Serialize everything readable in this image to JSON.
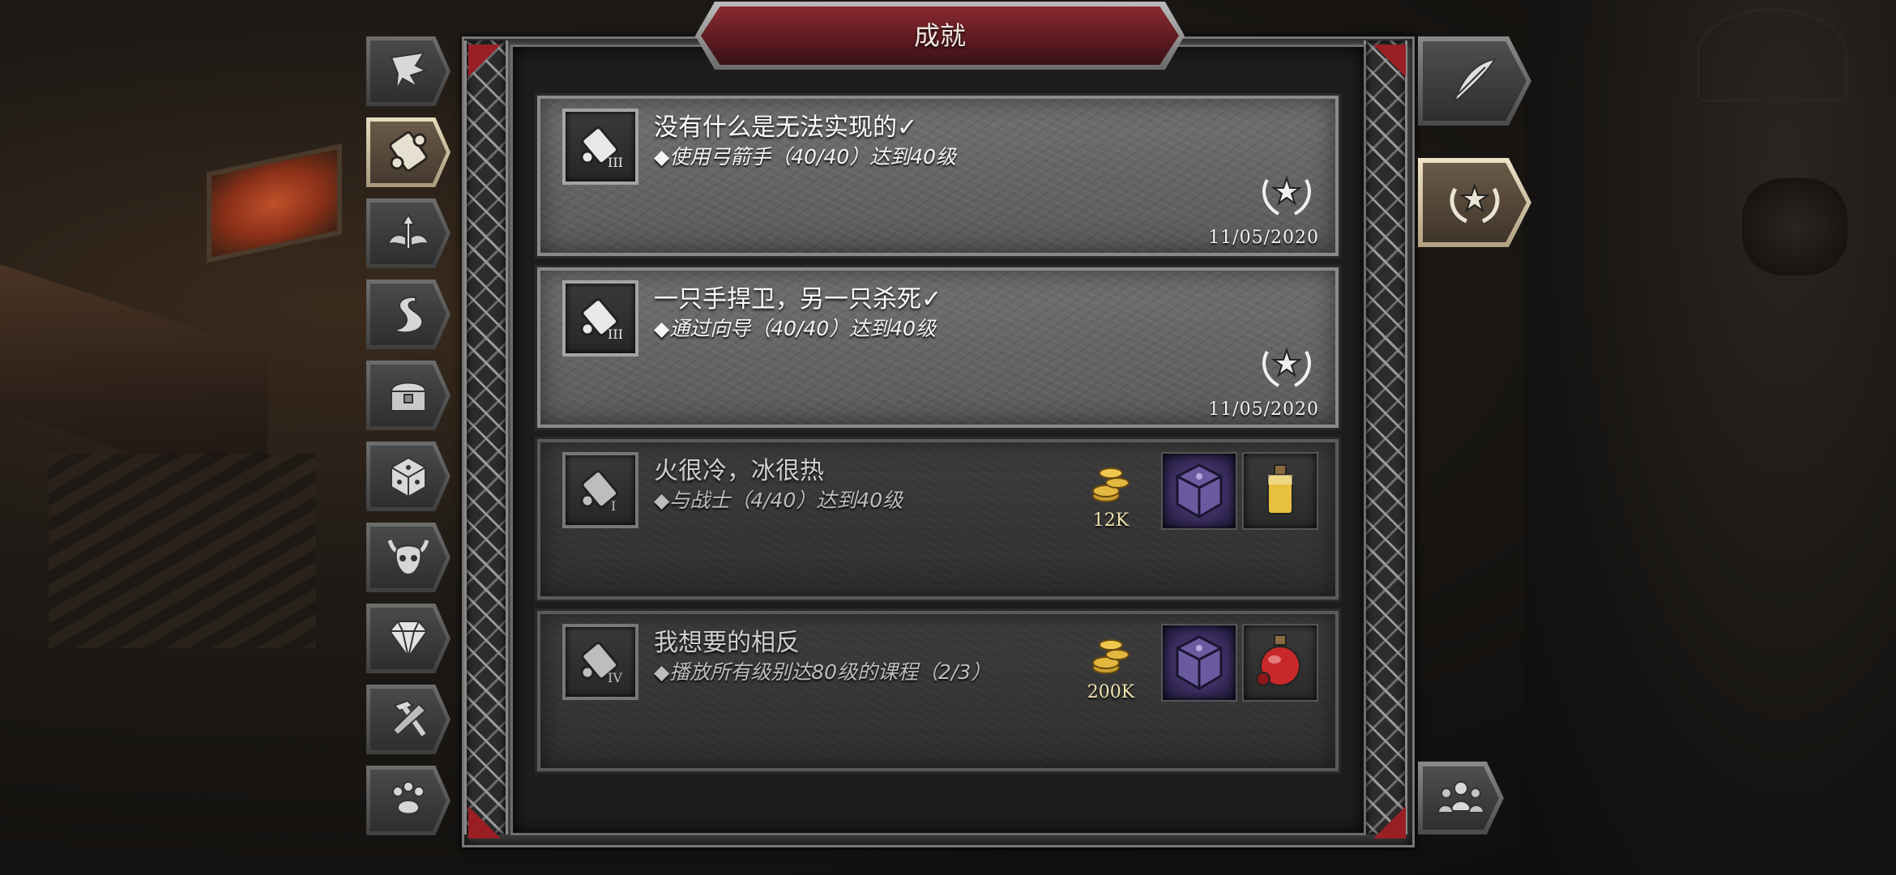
{
  "screen": {
    "title": "成就"
  },
  "side_tabs": [
    {
      "icon": "feather-quill-icon",
      "active": false
    },
    {
      "icon": "scroll-icon",
      "active": true
    },
    {
      "icon": "winged-arrow-icon",
      "active": false
    },
    {
      "icon": "serpent-icon",
      "active": false
    },
    {
      "icon": "treasure-chest-icon",
      "active": false
    },
    {
      "icon": "dice-icon",
      "active": false
    },
    {
      "icon": "demon-skull-icon",
      "active": false
    },
    {
      "icon": "diamond-icon",
      "active": false
    },
    {
      "icon": "hammer-icon",
      "active": false
    },
    {
      "icon": "paw-icon",
      "active": false
    }
  ],
  "right_tabs": [
    {
      "icon": "quill-icon",
      "active": false
    },
    {
      "icon": "laurel-star-icon",
      "active": true
    },
    {
      "icon": "group-icon",
      "active": false
    }
  ],
  "achievements": [
    {
      "title": "没有什么是无法实现的✓",
      "desc": "◆使用弓箭手（40/40）达到40级",
      "date": "11/05/2020",
      "completed": true,
      "icon": "scroll-tier-3-icon"
    },
    {
      "title": "一只手捍卫，另一只杀死✓",
      "desc": "◆通过向导（40/40）达到40级",
      "date": "11/05/2020",
      "completed": true,
      "icon": "scroll-tier-3-icon"
    },
    {
      "title": "火很冷，冰很热",
      "desc": "◆与战士（4/40）达到40级",
      "completed": false,
      "icon": "scroll-tier-1-icon",
      "rewards": {
        "gold": "12K",
        "item1": "cube-icon",
        "item2": "yellow-potion-icon"
      }
    },
    {
      "title": "我想要的相反",
      "desc": "◆播放所有级别达80级的课程（2/3）",
      "completed": false,
      "icon": "scroll-tier-4-icon",
      "rewards": {
        "gold": "200K",
        "item1": "cube-icon",
        "item2": "red-potion-icon"
      }
    }
  ],
  "colors": {
    "title_plaque": "#5a1a20",
    "frame": "#4a4a4a",
    "completed_card": "#646464",
    "pending_card": "#343434",
    "corner_gem": "#9a1f24"
  }
}
